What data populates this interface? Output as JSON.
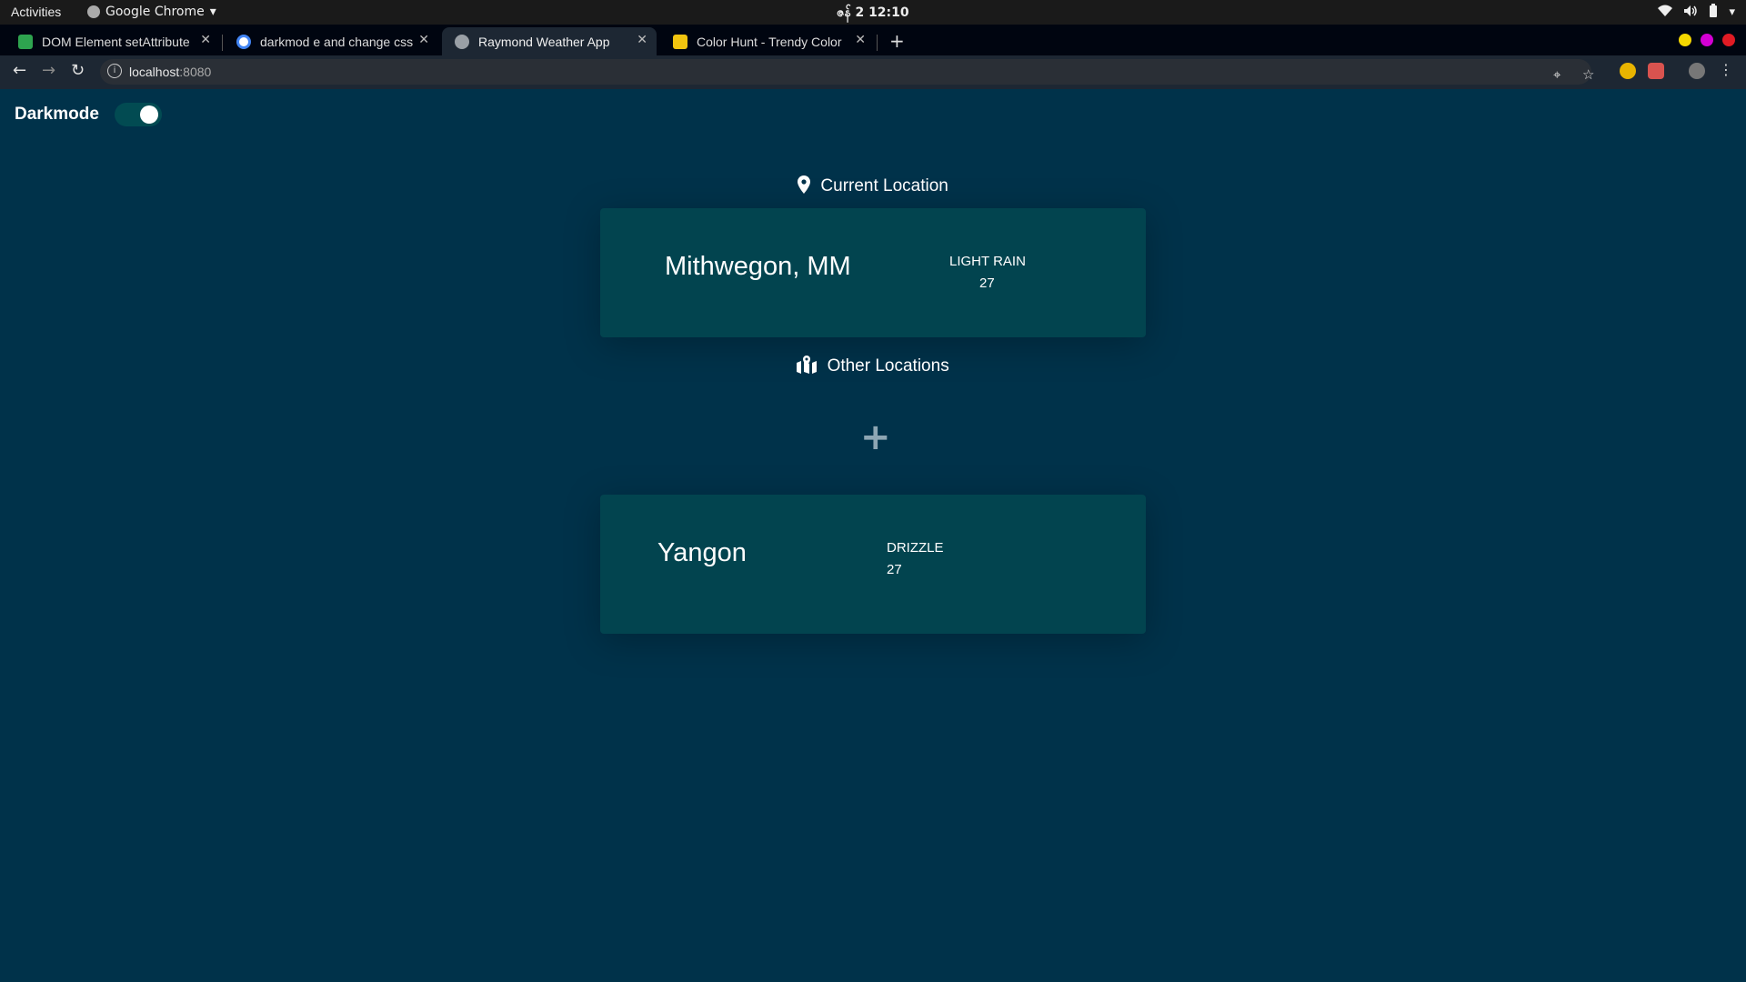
{
  "os": {
    "activities": "Activities",
    "app_name": "Google Chrome",
    "clock_date": "ဇန် 2",
    "clock_time": "12:10"
  },
  "browser": {
    "tabs": [
      {
        "title": "DOM Element setAttribute",
        "favicon_color": "#2ea44f"
      },
      {
        "title": "darkmod e and change css",
        "favicon_color": "#4285f4"
      },
      {
        "title": "Raymond Weather App",
        "favicon_color": "#9aa0a6"
      },
      {
        "title": "Color Hunt - Trendy Color",
        "favicon_color": "#f1c40f"
      }
    ],
    "url_host": "localhost",
    "url_port": ":8080",
    "window_dot_colors": [
      "#f5d800",
      "#d400d4",
      "#e01b24"
    ]
  },
  "app": {
    "darkmode_label": "Darkmode",
    "darkmode_enabled": true,
    "current_location_title": "Current Location",
    "other_locations_title": "Other Locations",
    "add_label": "+",
    "current": {
      "city": "Mithwegon, MM",
      "condition": "LIGHT RAIN",
      "temp": "27"
    },
    "others": [
      {
        "city": "Yangon",
        "condition": "DRIZZLE",
        "temp": "27"
      }
    ]
  },
  "colors": {
    "page_bg": "#00324a",
    "card_bg": "#02444f",
    "toggle_bg": "#024b52"
  }
}
